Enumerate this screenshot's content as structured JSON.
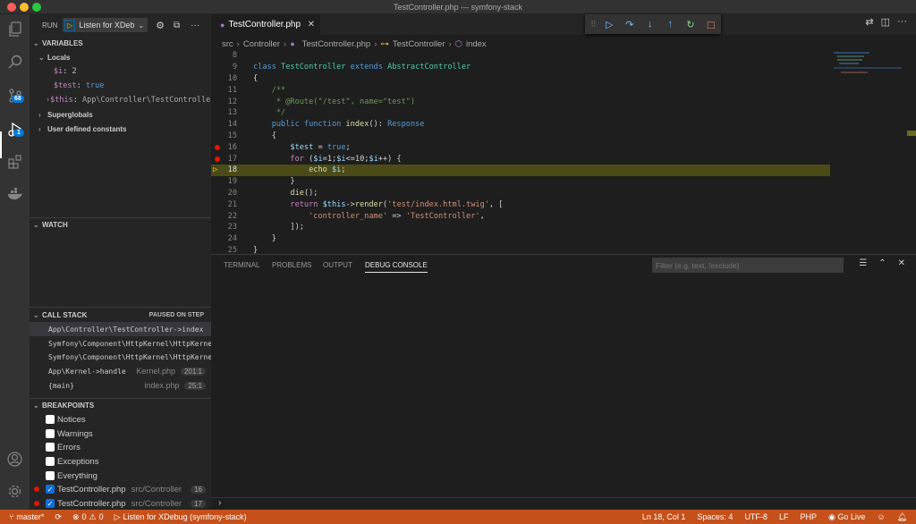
{
  "window": {
    "title": "TestController.php — symfony-stack"
  },
  "activity_bar": {
    "items": [
      {
        "name": "explorer",
        "icon": "files-icon"
      },
      {
        "name": "search",
        "icon": "search-icon"
      },
      {
        "name": "source-control",
        "icon": "source-control-icon",
        "badge": "68"
      },
      {
        "name": "run-debug",
        "icon": "debug-icon",
        "badge": "1",
        "active": true
      },
      {
        "name": "extensions",
        "icon": "extensions-icon"
      },
      {
        "name": "docker",
        "icon": "docker-icon"
      }
    ],
    "bottom": [
      {
        "name": "accounts",
        "icon": "account-icon"
      },
      {
        "name": "manage",
        "icon": "gear-icon"
      }
    ]
  },
  "run": {
    "label": "RUN",
    "config": "Listen for XDeb"
  },
  "variables": {
    "title": "VARIABLES",
    "locals_label": "Locals",
    "locals": [
      {
        "name": "$i",
        "value": "2"
      },
      {
        "name": "$test",
        "value": "true"
      },
      {
        "name": "$this",
        "value": "App\\Controller\\TestController"
      }
    ],
    "groups": [
      "Superglobals",
      "User defined constants"
    ]
  },
  "watch": {
    "title": "WATCH"
  },
  "call_stack": {
    "title": "CALL STACK",
    "status": "PAUSED ON STEP",
    "frames": [
      {
        "name": "App\\Controller\\TestController->index",
        "file": "",
        "pos": ""
      },
      {
        "name": "Symfony\\Component\\HttpKernel\\HttpKernel",
        "file": "",
        "pos": ""
      },
      {
        "name": "Symfony\\Component\\HttpKernel\\HttpKernel",
        "file": "",
        "pos": ""
      },
      {
        "name": "App\\Kernel->handle",
        "file": "Kernel.php",
        "pos": "201:1"
      },
      {
        "name": "{main}",
        "file": "index.php",
        "pos": "25:1"
      }
    ]
  },
  "breakpoints": {
    "title": "BREAKPOINTS",
    "exceptions": [
      {
        "label": "Notices",
        "checked": false
      },
      {
        "label": "Warnings",
        "checked": false
      },
      {
        "label": "Errors",
        "checked": false
      },
      {
        "label": "Exceptions",
        "checked": false
      },
      {
        "label": "Everything",
        "checked": false
      }
    ],
    "files": [
      {
        "file": "TestController.php",
        "path": "src/Controller",
        "line": "16",
        "checked": true
      },
      {
        "file": "TestController.php",
        "path": "src/Controller",
        "line": "17",
        "checked": true
      }
    ]
  },
  "editor": {
    "tab": "TestController.php",
    "breadcrumb": [
      "src",
      "Controller",
      "TestController.php",
      "TestController",
      "index"
    ],
    "current_line": 18,
    "breakpoint_lines": [
      16,
      17
    ],
    "lines": [
      {
        "n": "8",
        "tokens": []
      },
      {
        "n": "9",
        "tokens": [
          [
            "kw",
            "class "
          ],
          [
            "cls",
            "TestController "
          ],
          [
            "kw",
            "extends "
          ],
          [
            "cls",
            "AbstractController"
          ]
        ]
      },
      {
        "n": "10",
        "tokens": [
          [
            "pl",
            "{"
          ]
        ]
      },
      {
        "n": "11",
        "tokens": [
          [
            "pl",
            "    "
          ],
          [
            "cm",
            "/**"
          ]
        ]
      },
      {
        "n": "12",
        "tokens": [
          [
            "pl",
            "     "
          ],
          [
            "cm",
            "* @Route(\"/test\", name=\"test\")"
          ]
        ]
      },
      {
        "n": "13",
        "tokens": [
          [
            "pl",
            "     "
          ],
          [
            "cm",
            "*/"
          ]
        ]
      },
      {
        "n": "14",
        "tokens": [
          [
            "pl",
            "    "
          ],
          [
            "kw",
            "public function "
          ],
          [
            "fn",
            "index"
          ],
          [
            "pl",
            "(): "
          ],
          [
            "kw",
            "Response"
          ]
        ]
      },
      {
        "n": "15",
        "tokens": [
          [
            "pl",
            "    {"
          ]
        ]
      },
      {
        "n": "16",
        "tokens": [
          [
            "pl",
            "        "
          ],
          [
            "var",
            "$test"
          ],
          [
            "pl",
            " = "
          ],
          [
            "kw",
            "true"
          ],
          [
            "pl",
            ";"
          ]
        ]
      },
      {
        "n": "17",
        "tokens": [
          [
            "pl",
            "        "
          ],
          [
            "ctl",
            "for"
          ],
          [
            "pl",
            " ("
          ],
          [
            "var",
            "$i"
          ],
          [
            "pl",
            "=1;"
          ],
          [
            "var",
            "$i"
          ],
          [
            "pl",
            "<=10;"
          ],
          [
            "var",
            "$i"
          ],
          [
            "pl",
            "++) {"
          ]
        ]
      },
      {
        "n": "18",
        "tokens": [
          [
            "pl",
            "            "
          ],
          [
            "fn",
            "echo "
          ],
          [
            "var",
            "$i"
          ],
          [
            "pl",
            ";"
          ]
        ]
      },
      {
        "n": "19",
        "tokens": [
          [
            "pl",
            "        }"
          ]
        ]
      },
      {
        "n": "20",
        "tokens": [
          [
            "pl",
            "        "
          ],
          [
            "fn",
            "die"
          ],
          [
            "pl",
            "();"
          ]
        ]
      },
      {
        "n": "21",
        "tokens": [
          [
            "pl",
            "        "
          ],
          [
            "ctl",
            "return "
          ],
          [
            "var",
            "$this"
          ],
          [
            "pl",
            "->"
          ],
          [
            "fn",
            "render"
          ],
          [
            "pl",
            "("
          ],
          [
            "str",
            "'test/index.html.twig'"
          ],
          [
            "pl",
            ", ["
          ]
        ]
      },
      {
        "n": "22",
        "tokens": [
          [
            "pl",
            "            "
          ],
          [
            "str",
            "'controller_name'"
          ],
          [
            "pl",
            " => "
          ],
          [
            "str",
            "'TestController'"
          ],
          [
            "pl",
            ","
          ]
        ]
      },
      {
        "n": "23",
        "tokens": [
          [
            "pl",
            "        ]);"
          ]
        ]
      },
      {
        "n": "24",
        "tokens": [
          [
            "pl",
            "    }"
          ]
        ]
      },
      {
        "n": "25",
        "tokens": [
          [
            "pl",
            "}"
          ]
        ]
      }
    ]
  },
  "debug_toolbar": [
    {
      "name": "continue",
      "glyph": "▷",
      "color": "#75beff"
    },
    {
      "name": "step-over",
      "glyph": "↷",
      "color": "#75beff"
    },
    {
      "name": "step-into",
      "glyph": "↓",
      "color": "#75beff"
    },
    {
      "name": "step-out",
      "glyph": "↑",
      "color": "#75beff"
    },
    {
      "name": "restart",
      "glyph": "↻",
      "color": "#89d185"
    },
    {
      "name": "stop",
      "glyph": "□",
      "color": "#f48771"
    }
  ],
  "panel": {
    "tabs": [
      "TERMINAL",
      "PROBLEMS",
      "OUTPUT",
      "DEBUG CONSOLE"
    ],
    "active_tab": "DEBUG CONSOLE",
    "filter_placeholder": "Filter (e.g. text, !exclude)"
  },
  "status_bar": {
    "branch": "master*",
    "errors": "0",
    "warnings": "0",
    "debug": "Listen for XDebug (symfony-stack)",
    "position": "Ln 18, Col 1",
    "spaces": "Spaces: 4",
    "encoding": "UTF-8",
    "eol": "LF",
    "language": "PHP",
    "go_live": "Go Live",
    "color": "#c5501a"
  }
}
